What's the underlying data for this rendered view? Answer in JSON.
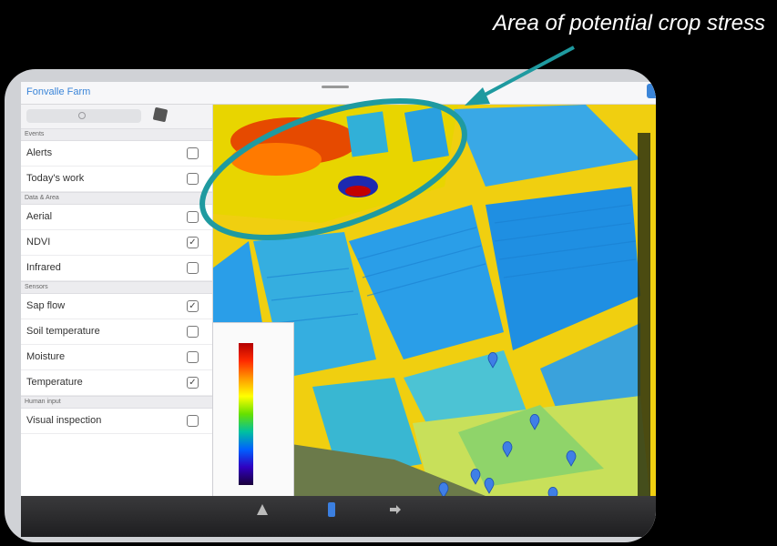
{
  "annotation": "Area of potential crop stress",
  "app": {
    "title": "Fonvalle Farm"
  },
  "sidebar": {
    "sections": [
      {
        "title": "Events",
        "items": [
          {
            "label": "Alerts",
            "checked": false
          },
          {
            "label": "Today's work",
            "checked": false
          }
        ]
      },
      {
        "title": "Data & Area",
        "items": [
          {
            "label": "Aerial",
            "checked": false
          },
          {
            "label": "NDVI",
            "checked": true
          },
          {
            "label": "Infrared",
            "checked": false
          }
        ]
      },
      {
        "title": "Sensors",
        "items": [
          {
            "label": "Sap flow",
            "checked": true
          },
          {
            "label": "Soil temperature",
            "checked": false
          },
          {
            "label": "Moisture",
            "checked": false
          },
          {
            "label": "Temperature",
            "checked": true
          }
        ]
      },
      {
        "title": "Human input",
        "items": [
          {
            "label": "Visual inspection",
            "checked": false
          }
        ]
      }
    ]
  },
  "icons": {
    "search": "search-icon",
    "layers": "layers-icon",
    "sensor_pin": "map-pin-icon"
  },
  "colors": {
    "annotation_ring": "#1f9aa0",
    "sensor_pin": "#3f7fe6",
    "accent": "#3b85d8"
  }
}
